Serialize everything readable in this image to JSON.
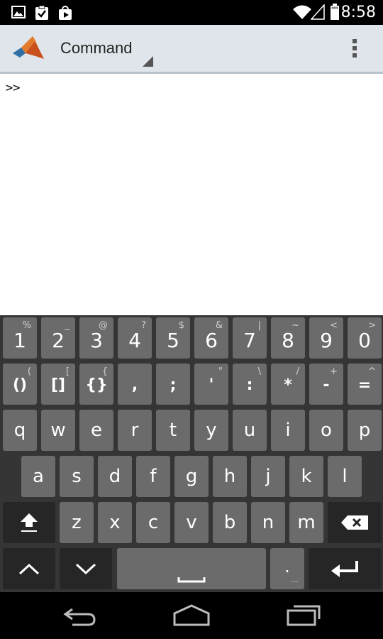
{
  "status_bar": {
    "time": "8:58",
    "left_icons": [
      "image-icon",
      "task-check-icon",
      "play-store-icon"
    ],
    "right_icons": [
      "wifi-icon",
      "signal-icon",
      "battery-icon"
    ]
  },
  "action_bar": {
    "title": "Command",
    "logo": "matlab-logo",
    "accent": "#dfe5ea"
  },
  "command_window": {
    "prompt": ">>"
  },
  "keyboard": {
    "row0": [
      {
        "main": "1",
        "alt": "%"
      },
      {
        "main": "2",
        "alt": "_"
      },
      {
        "main": "3",
        "alt": "@"
      },
      {
        "main": "4",
        "alt": "?"
      },
      {
        "main": "5",
        "alt": "$"
      },
      {
        "main": "6",
        "alt": "&"
      },
      {
        "main": "7",
        "alt": "|"
      },
      {
        "main": "8",
        "alt": "~"
      },
      {
        "main": "9",
        "alt": "<"
      },
      {
        "main": "0",
        "alt": ">"
      }
    ],
    "row1": [
      {
        "main": "()",
        "alt": "("
      },
      {
        "main": "[]",
        "alt": "["
      },
      {
        "main": "{}",
        "alt": "{"
      },
      {
        "main": ",",
        "alt": ""
      },
      {
        "main": ";",
        "alt": ""
      },
      {
        "main": "'",
        "alt": "\""
      },
      {
        "main": ":",
        "alt": "\\"
      },
      {
        "main": "*",
        "alt": "/"
      },
      {
        "main": "-",
        "alt": "+"
      },
      {
        "main": "=",
        "alt": "^"
      }
    ],
    "row2": [
      "q",
      "w",
      "e",
      "r",
      "t",
      "y",
      "u",
      "i",
      "o",
      "p"
    ],
    "row3": [
      "a",
      "s",
      "d",
      "f",
      "g",
      "h",
      "j",
      "k",
      "l"
    ],
    "row4": [
      "z",
      "x",
      "c",
      "v",
      "b",
      "n",
      "m"
    ],
    "period_key": {
      "main": ".",
      "alt": "..."
    },
    "key_color": "#6b6b6b",
    "special_key_color": "#262626"
  },
  "nav_bar": {
    "buttons": [
      "back-icon",
      "home-icon",
      "recents-icon"
    ]
  }
}
